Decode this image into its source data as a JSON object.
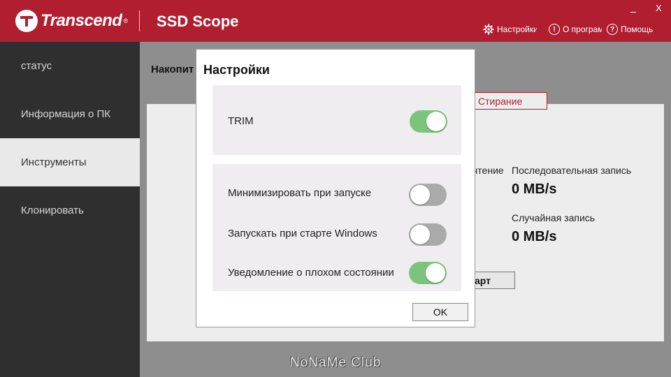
{
  "header": {
    "logo_text": "Transcend",
    "logo_reg": "®",
    "app_title": "SSD Scope",
    "window_min": "_",
    "window_close": "X",
    "menu": {
      "settings_label": "Настройки",
      "about_label": "О програм",
      "help_label": "Помощь",
      "about_icon_glyph": "!",
      "help_icon_glyph": "?"
    },
    "colors": {
      "brand": "#b01e30"
    }
  },
  "sidebar": {
    "items": [
      {
        "label": "статус",
        "active": false
      },
      {
        "label": "Информация о ПК",
        "active": false
      },
      {
        "label": "Инструменты",
        "active": true
      },
      {
        "label": "Клонировать",
        "active": false
      }
    ]
  },
  "main": {
    "title": "Накопит",
    "erase_tab": "Стирание",
    "seq_read_label_partial": "чтение",
    "seq_write_label": "Последовательная запись",
    "seq_write_value": "0 MB/s",
    "rand_write_label": "Случайная запись",
    "rand_write_value": "0 MB/s",
    "start_button": "арт"
  },
  "dialog": {
    "title": "Настройки",
    "options": [
      {
        "label": "TRIM",
        "on": true
      },
      {
        "label": "Минимизировать при запуске",
        "on": false
      },
      {
        "label": "Запускать при старте Windows",
        "on": false
      },
      {
        "label": "Уведомление о плохом состоянии",
        "on": true
      }
    ],
    "ok_label": "OK",
    "toggle_on_color": "#7cc47c",
    "toggle_off_color": "#aaaaaa"
  },
  "watermark": "NoNaMe Club"
}
